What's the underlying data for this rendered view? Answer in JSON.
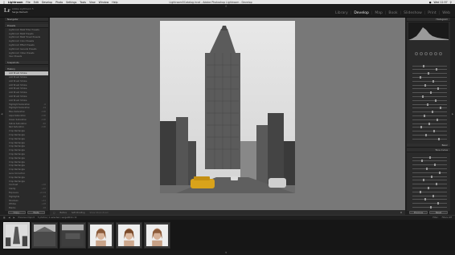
{
  "menubar": {
    "items": [
      "Lightroom",
      "File",
      "Edit",
      "Develop",
      "Photo",
      "Settings",
      "Tools",
      "View",
      "Window",
      "Help"
    ],
    "window_title": "Lightroom5Catalog.lrcat - Adobe Photoshop Lightroom - Develop",
    "clock": "Wed 12:57"
  },
  "identity": {
    "logo": "Lr",
    "line1": "Adobe Lightroom 5",
    "line2": "Serge Ramelli"
  },
  "modules": [
    "Library",
    "Develop",
    "Map",
    "Book",
    "Slideshow",
    "Print",
    "Web"
  ],
  "active_module": "Develop",
  "left_panel": {
    "navigator_label": "Navigator",
    "presets_label": "Presets",
    "snapshots_label": "Snapshots",
    "history_label": "History",
    "preset_rows": [
      "Lightroom B&W Filter Presets",
      "Lightroom B&W Presets",
      "Lightroom B&W Toned Presets",
      "Lightroom Color Presets",
      "Lightroom Effect Presets",
      "Lightroom General Presets",
      "Lightroom Video Presets",
      "User Presets"
    ],
    "history_rows": [
      {
        "label": "Add Brush Stroke",
        "count": ""
      },
      {
        "label": "Add Brush Stroke",
        "count": ""
      },
      {
        "label": "Add Brush Stroke",
        "count": ""
      },
      {
        "label": "Add Brush Stroke",
        "count": ""
      },
      {
        "label": "Add Brush Stroke",
        "count": ""
      },
      {
        "label": "Add Brush Stroke",
        "count": ""
      },
      {
        "label": "Add Brush Stroke",
        "count": ""
      },
      {
        "label": "Add Brush Stroke",
        "count": ""
      },
      {
        "label": "Highlight Saturation",
        "count": "-6"
      },
      {
        "label": "Highlight Saturation",
        "count": "-19"
      },
      {
        "label": "Blue Saturation",
        "count": "-100"
      },
      {
        "label": "Aqua Saturation",
        "count": "-100"
      },
      {
        "label": "Green Saturation",
        "count": "-100"
      },
      {
        "label": "Yellow Saturation",
        "count": "-60"
      },
      {
        "label": "Red Saturation",
        "count": "-100"
      },
      {
        "label": "Crop Rectangle",
        "count": ""
      },
      {
        "label": "Crop Rectangle",
        "count": ""
      },
      {
        "label": "Crop Rectangle",
        "count": ""
      },
      {
        "label": "Crop Rectangle",
        "count": ""
      },
      {
        "label": "Crop Rectangle",
        "count": ""
      },
      {
        "label": "Crop Rectangle",
        "count": ""
      },
      {
        "label": "Crop Rectangle",
        "count": ""
      },
      {
        "label": "Crop Rectangle",
        "count": ""
      },
      {
        "label": "Crop Rectangle",
        "count": ""
      },
      {
        "label": "Crop Rectangle",
        "count": ""
      },
      {
        "label": "Crop Rectangle",
        "count": ""
      },
      {
        "label": "Lens Correction",
        "count": ""
      },
      {
        "label": "Crop Rectangle",
        "count": ""
      },
      {
        "label": "Crop Rectangle",
        "count": ""
      },
      {
        "label": "Contrast",
        "count": "+16"
      },
      {
        "label": "Clarity",
        "count": "+42"
      },
      {
        "label": "Exposure",
        "count": "+0.19"
      },
      {
        "label": "Highlights",
        "count": "-38"
      },
      {
        "label": "Shadows",
        "count": "+41"
      },
      {
        "label": "Whites",
        "count": "+28"
      },
      {
        "label": "Blacks",
        "count": "-18"
      },
      {
        "label": "Import",
        "count": ""
      }
    ],
    "copy_button": "Copy...",
    "paste_button": "Paste"
  },
  "toolbar": {
    "soft_proofing": "Soft Proofing",
    "before_after": "Before",
    "show_stuck": "Show Stuck Zoom"
  },
  "right_panel": {
    "histogram_label": "Histogram",
    "basic_label": "Basic",
    "tone_curve_label": "Tone Curve",
    "previous_button": "Previous",
    "reset_button": "Reset"
  },
  "filmstrip_bar": {
    "collection": "Previous Import",
    "info": "5 photos / 1 selected / serge0012.cr2",
    "filter_label": "Filter:",
    "filter_value": "Filters Off"
  },
  "colors": {
    "accent_selected": "#cfcfcf",
    "panel_bg": "#2a2a2a",
    "canvas_bg": "#787878"
  }
}
